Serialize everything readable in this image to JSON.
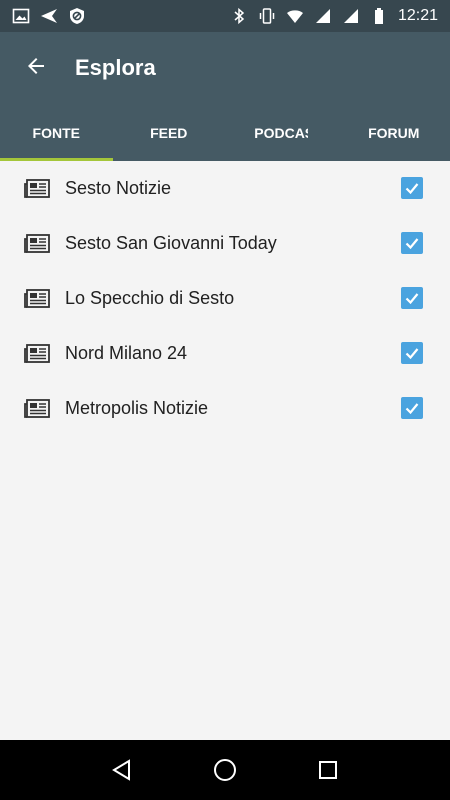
{
  "status_bar": {
    "time": "12:21",
    "icons_left": [
      "image-icon",
      "send-icon",
      "blocked-icon"
    ],
    "icons_right": [
      "bluetooth-icon",
      "vibrate-icon",
      "wifi-icon",
      "signal-icon",
      "signal-icon",
      "battery-icon"
    ]
  },
  "app_bar": {
    "title": "Esplora",
    "back_icon": "arrow-back-icon"
  },
  "tabs": [
    {
      "label": "FONTE",
      "active": true
    },
    {
      "label": "FEED",
      "active": false
    },
    {
      "label": "PODCAST",
      "active": false
    },
    {
      "label": "FORUM",
      "active": false
    }
  ],
  "sources": [
    {
      "label": "Sesto Notizie",
      "checked": true
    },
    {
      "label": "Sesto San Giovanni Today",
      "checked": true
    },
    {
      "label": "Lo Specchio di Sesto",
      "checked": true
    },
    {
      "label": "Nord Milano 24",
      "checked": true
    },
    {
      "label": "Metropolis Notizie",
      "checked": true
    }
  ],
  "colors": {
    "status_bar": "#37474f",
    "app_bar": "#455a64",
    "tab_indicator": "#a4c63a",
    "checkbox": "#4aa3df",
    "background": "#f4f4f4"
  }
}
